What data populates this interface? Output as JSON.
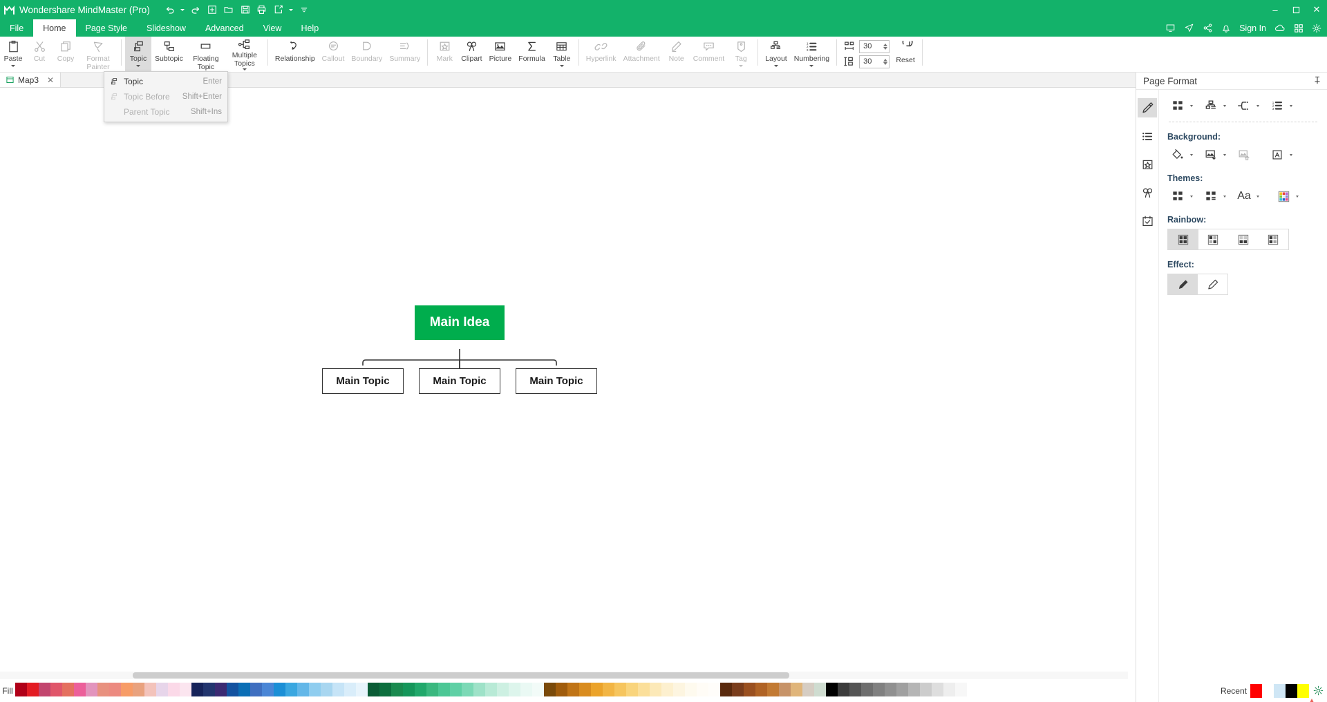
{
  "window": {
    "app_title": "Wondershare MindMaster (Pro)",
    "logo_icon": "mindmaster-logo-icon",
    "quick_access": [
      {
        "name": "undo-button",
        "icon": "undo-icon",
        "has_caret": true
      },
      {
        "name": "redo-button",
        "icon": "redo-icon",
        "has_caret": false
      },
      {
        "name": "new-button",
        "icon": "plus-square-icon",
        "has_caret": false
      },
      {
        "name": "open-button",
        "icon": "folder-icon",
        "has_caret": false
      },
      {
        "name": "save-button",
        "icon": "save-disk-icon",
        "has_caret": false
      },
      {
        "name": "print-button",
        "icon": "printer-icon",
        "has_caret": false
      },
      {
        "name": "export-share-button",
        "icon": "export-icon",
        "has_caret": true
      },
      {
        "name": "customize-qat-button",
        "icon": "overflow-icon",
        "has_caret": false
      }
    ],
    "controls": {
      "minimize": "–",
      "maximize": "❐",
      "close": "✕"
    },
    "accent_color": "#13b26a"
  },
  "menubar": {
    "tabs": [
      {
        "label": "File",
        "active": false
      },
      {
        "label": "Home",
        "active": true
      },
      {
        "label": "Page Style",
        "active": false
      },
      {
        "label": "Slideshow",
        "active": false
      },
      {
        "label": "Advanced",
        "active": false
      },
      {
        "label": "View",
        "active": false
      },
      {
        "label": "Help",
        "active": false
      }
    ],
    "right_icons": [
      "monitor-icon",
      "send-icon",
      "share-nodes-icon",
      "bell-icon"
    ],
    "signin_label": "Sign In",
    "right_icons_2": [
      "cloud-icon",
      "grid-apps-icon",
      "gear-icon"
    ]
  },
  "ribbon": {
    "groups": [
      {
        "name": "clipboard",
        "items": [
          {
            "label": "Paste",
            "icon": "paste-icon",
            "disabled": false,
            "caret": true
          },
          {
            "label": "Cut",
            "icon": "scissors-icon",
            "disabled": true,
            "caret": false
          },
          {
            "label": "Copy",
            "icon": "copy-icon",
            "disabled": true,
            "caret": false
          },
          {
            "label": "Format Painter",
            "icon": "format-painter-icon",
            "disabled": true,
            "caret": false
          }
        ]
      },
      {
        "name": "topics",
        "items": [
          {
            "label": "Topic",
            "icon": "topic-icon",
            "disabled": false,
            "caret": true,
            "active": true
          },
          {
            "label": "Subtopic",
            "icon": "subtopic-icon",
            "disabled": false,
            "caret": false
          },
          {
            "label": "Floating Topic",
            "icon": "floating-topic-icon",
            "disabled": false,
            "caret": false
          },
          {
            "label": "Multiple Topics",
            "icon": "multiple-topics-icon",
            "disabled": false,
            "caret": true
          }
        ]
      },
      {
        "name": "structure",
        "items": [
          {
            "label": "Relationship",
            "icon": "relationship-icon",
            "disabled": false,
            "caret": false
          },
          {
            "label": "Callout",
            "icon": "callout-icon",
            "disabled": true,
            "caret": false
          },
          {
            "label": "Boundary",
            "icon": "boundary-icon",
            "disabled": true,
            "caret": false
          },
          {
            "label": "Summary",
            "icon": "summary-icon",
            "disabled": true,
            "caret": false
          }
        ]
      },
      {
        "name": "insert",
        "items": [
          {
            "label": "Mark",
            "icon": "mark-star-icon",
            "disabled": true,
            "caret": false
          },
          {
            "label": "Clipart",
            "icon": "clipart-clover-icon",
            "disabled": false,
            "caret": false
          },
          {
            "label": "Picture",
            "icon": "picture-icon",
            "disabled": false,
            "caret": false
          },
          {
            "label": "Formula",
            "icon": "sigma-formula-icon",
            "disabled": false,
            "caret": false
          },
          {
            "label": "Table",
            "icon": "table-grid-icon",
            "disabled": false,
            "caret": true
          }
        ]
      },
      {
        "name": "annotate",
        "items": [
          {
            "label": "Hyperlink",
            "icon": "hyperlink-icon",
            "disabled": true,
            "caret": false
          },
          {
            "label": "Attachment",
            "icon": "paperclip-icon",
            "disabled": true,
            "caret": false
          },
          {
            "label": "Note",
            "icon": "note-pencil-icon",
            "disabled": true,
            "caret": false
          },
          {
            "label": "Comment",
            "icon": "comment-bubble-icon",
            "disabled": true,
            "caret": false
          },
          {
            "label": "Tag",
            "icon": "tag-icon",
            "disabled": true,
            "caret": true
          }
        ]
      },
      {
        "name": "layout",
        "items": [
          {
            "label": "Layout",
            "icon": "layout-tree-icon",
            "disabled": false,
            "caret": true
          },
          {
            "label": "Numbering",
            "icon": "numbering-list-icon",
            "disabled": false,
            "caret": true
          }
        ]
      }
    ],
    "spacing": {
      "horizontal": {
        "icon": "horizontal-spacing-icon",
        "value": "30"
      },
      "vertical": {
        "icon": "vertical-spacing-icon",
        "value": "30"
      }
    },
    "reset": {
      "label": "Reset",
      "icon": "reset-circular-arrow-icon"
    }
  },
  "topic_menu": {
    "items": [
      {
        "label": "Topic",
        "shortcut": "Enter",
        "icon": "topic-icon",
        "disabled": false
      },
      {
        "label": "Topic Before",
        "shortcut": "Shift+Enter",
        "icon": "topic-icon",
        "disabled": true
      },
      {
        "label": "Parent Topic",
        "shortcut": "Shift+Ins",
        "icon": "",
        "disabled": true
      }
    ]
  },
  "doc_tabs": [
    {
      "label": "Map3",
      "icon": "map-doc-icon",
      "close": "✕",
      "active": true
    }
  ],
  "canvas": {
    "central_topic": {
      "text": "Main Idea",
      "fill": "#00ad4d",
      "text_color": "#ffffff"
    },
    "main_topics": [
      {
        "text": "Main Topic"
      },
      {
        "text": "Main Topic"
      },
      {
        "text": "Main Topic"
      }
    ],
    "connector_color": "#333333"
  },
  "page_format": {
    "title": "Page Format",
    "pin_icon": "pin-icon",
    "rail": [
      {
        "name": "page-format-tab",
        "icon": "paint-bucket-brush-icon",
        "active": true
      },
      {
        "name": "outline-tab",
        "icon": "bullet-list-icon",
        "active": false
      },
      {
        "name": "mark-tab",
        "icon": "mark-star-box-icon",
        "active": false
      },
      {
        "name": "clipart-tab",
        "icon": "clipart-clover-icon",
        "active": false
      },
      {
        "name": "task-tab",
        "icon": "task-check-icon",
        "active": false
      }
    ],
    "top_tools": [
      {
        "name": "theme-layout-button",
        "icon": "grid-four-icon",
        "caret": true
      },
      {
        "name": "map-structure-button",
        "icon": "structure-tree-icon",
        "caret": true
      },
      {
        "name": "branch-style-button",
        "icon": "branch-connector-icon",
        "caret": true
      },
      {
        "name": "numbering-button",
        "icon": "numbering-list-icon",
        "caret": true
      }
    ],
    "background": {
      "title": "Background:",
      "tools": [
        {
          "name": "background-fill-button",
          "icon": "paint-bucket-icon",
          "caret": true,
          "disabled": false
        },
        {
          "name": "background-image-button",
          "icon": "image-insert-icon",
          "caret": true,
          "disabled": false
        },
        {
          "name": "remove-background-image-button",
          "icon": "image-delete-icon",
          "caret": false,
          "disabled": true
        },
        {
          "name": "watermark-button",
          "icon": "text-watermark-icon",
          "caret": true,
          "disabled": false
        }
      ]
    },
    "themes": {
      "title": "Themes:",
      "tools": [
        {
          "name": "theme-gallery-button",
          "icon": "grid-four-icon",
          "caret": true
        },
        {
          "name": "theme-style-button",
          "icon": "grid-list-icon",
          "caret": true
        },
        {
          "name": "theme-font-button",
          "icon": "font-aa-icon",
          "caret": true
        },
        {
          "name": "theme-color-button",
          "icon": "color-palette-icon",
          "caret": true
        }
      ]
    },
    "rainbow": {
      "title": "Rainbow:",
      "options": [
        {
          "name": "rainbow-option-1",
          "selected": true
        },
        {
          "name": "rainbow-option-2",
          "selected": false
        },
        {
          "name": "rainbow-option-3",
          "selected": false
        },
        {
          "name": "rainbow-option-4",
          "selected": false
        }
      ]
    },
    "effect": {
      "title": "Effect:",
      "options": [
        {
          "name": "effect-option-1",
          "icon": "pen-solid-icon",
          "selected": true
        },
        {
          "name": "effect-option-2",
          "icon": "pen-outline-icon",
          "selected": false
        }
      ]
    }
  },
  "color_bar": {
    "fill_label": "Fill",
    "recent_label": "Recent",
    "settings_icon": "gear-icon",
    "swatches": [
      "#b00018",
      "#e31b23",
      "#c2456e",
      "#e0566a",
      "#e4705f",
      "#ec5f9a",
      "#e294bd",
      "#e8917f",
      "#ec8a80",
      "#f79c67",
      "#e9a27e",
      "#f3c3bb",
      "#e7d5ea",
      "#fbd9e8",
      "#fbe5ef",
      "#16235a",
      "#22356e",
      "#3b2a72",
      "#1352a0",
      "#0b6eb5",
      "#3f6fc0",
      "#4a86d6",
      "#1b8fd6",
      "#3aa7e0",
      "#63b7e8",
      "#8fcdef",
      "#a8d6f0",
      "#c6e4f7",
      "#d9edfa",
      "#e8f4fc",
      "#0b5c36",
      "#0d6f3e",
      "#1a8a4f",
      "#15965a",
      "#21a86b",
      "#3ab87f",
      "#4cc795",
      "#5fd0a5",
      "#7cd9b6",
      "#9ee2c8",
      "#b8ead6",
      "#cdf0e2",
      "#ddf5ec",
      "#eaf9f4",
      "#f2fbf8",
      "#7a4a0a",
      "#a05c0c",
      "#c07416",
      "#d98c1f",
      "#eba32a",
      "#f2b544",
      "#f6c55e",
      "#f9d47c",
      "#fbdf9a",
      "#fce9b8",
      "#fdf0cf",
      "#fdf5e0",
      "#fefaee",
      "#fffcf6",
      "#fffdfa",
      "#5a2a0e",
      "#7a3d1c",
      "#9a5020",
      "#b06325",
      "#c27a33",
      "#c79368",
      "#e0b57a",
      "#d6cdc3",
      "#cfdcd0",
      "#000000",
      "#3b3b3b",
      "#555555",
      "#6e6e6e",
      "#808080",
      "#909090",
      "#a0a0a0",
      "#b5b5b5",
      "#cccccc",
      "#dedede",
      "#eeeeee",
      "#f7f7f7",
      "#ffffff"
    ],
    "recent_swatches": [
      "#ff0000",
      "#ffffff",
      "#cfe6f5",
      "#000000",
      "#ffff00"
    ]
  }
}
